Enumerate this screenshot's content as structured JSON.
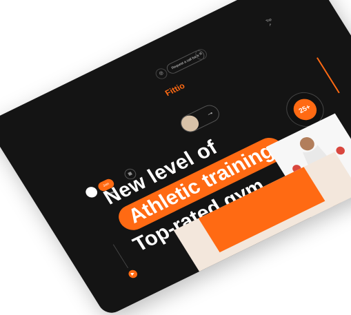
{
  "brand": {
    "logo_text": "Fittio"
  },
  "header": {
    "location_icon": "location-icon",
    "cta_label": "Request a call back",
    "menu_icon": "menu-icon"
  },
  "left_controls": {
    "primary_button": "Join now"
  },
  "hero": {
    "line1": "New level of",
    "line2": "Athletic training",
    "line3": "Top-rated gym"
  },
  "badge": {
    "value": "25+"
  },
  "side": {
    "play_icon": "play-icon"
  },
  "colors": {
    "accent": "#ff6a13",
    "background": "#141414",
    "text": "#ffffff"
  }
}
